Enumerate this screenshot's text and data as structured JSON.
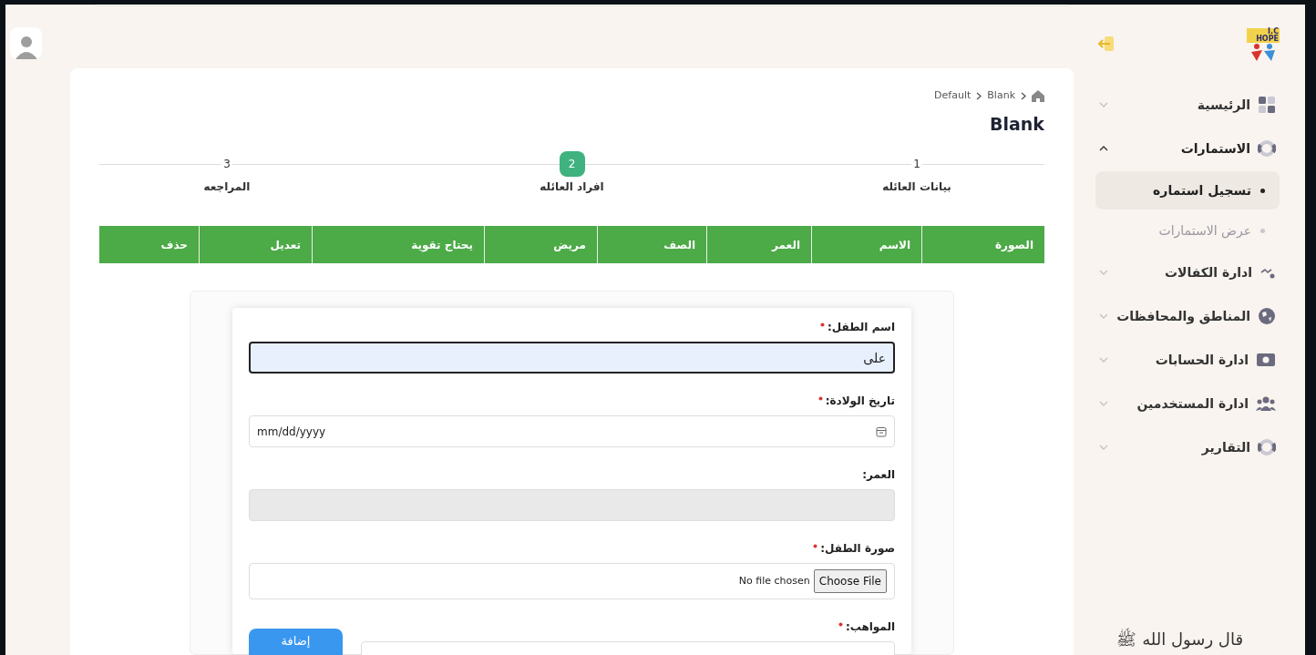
{
  "sidebar": {
    "logo_text": "I.C HOPE",
    "items": [
      {
        "label": "الرئيسية",
        "expanded": false
      },
      {
        "label": "الاستمارات",
        "expanded": true,
        "children": [
          {
            "label": "تسجيل استماره",
            "selected": true
          },
          {
            "label": "عرض الاستمارات",
            "selected": false
          }
        ]
      },
      {
        "label": "ادارة الكفالات",
        "expanded": false
      },
      {
        "label": "المناطق والمحافظات",
        "expanded": false
      },
      {
        "label": "ادارة الحسابات",
        "expanded": false
      },
      {
        "label": "ادارة المستخدمين",
        "expanded": false
      },
      {
        "label": "التقارير",
        "expanded": false
      }
    ],
    "footer": "قال رسول الله ﷺ"
  },
  "breadcrumb": [
    "Blank",
    "Default"
  ],
  "page_title": "Blank",
  "steps": [
    {
      "number": "1",
      "label": "بيانات العائله",
      "selected": false
    },
    {
      "number": "2",
      "label": "افراد العائله",
      "selected": true
    },
    {
      "number": "3",
      "label": "المراجعه",
      "selected": false
    }
  ],
  "table": {
    "columns": [
      "الصورة",
      "الاسم",
      "العمر",
      "الصف",
      "مريض",
      "يحتاج تقوية",
      "تعديل",
      "حذف"
    ]
  },
  "form": {
    "fields": [
      {
        "kind": "text",
        "label": "اسم الطفل:",
        "required": true,
        "value": "على",
        "focused": true
      },
      {
        "kind": "date",
        "label": "تاريخ الولادة:",
        "required": true,
        "placeholder": "mm/dd/yyyy"
      },
      {
        "kind": "disabled",
        "label": "العمر:",
        "required": false
      },
      {
        "kind": "file",
        "label": "صورة الطفل:",
        "required": true,
        "button": "Choose File",
        "status": "No file chosen"
      },
      {
        "kind": "talents",
        "label": "المواهب:",
        "required": true,
        "button": "إضافة"
      }
    ]
  }
}
